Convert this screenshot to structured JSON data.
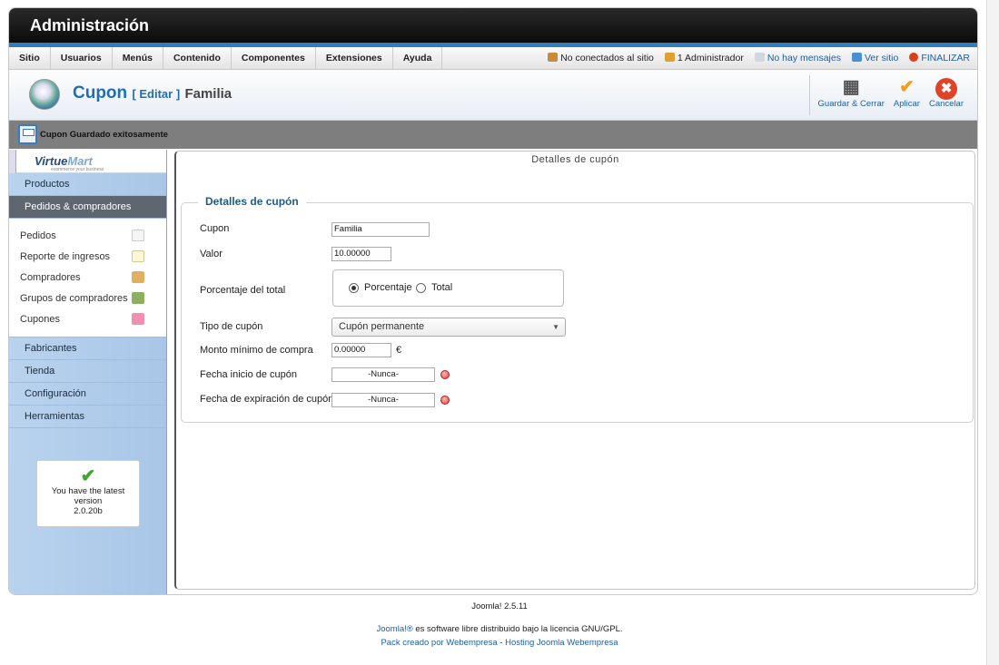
{
  "header": {
    "title": "Administración"
  },
  "menu": [
    "Sitio",
    "Usuarios",
    "Menús",
    "Contenido",
    "Componentes",
    "Extensiones",
    "Ayuda"
  ],
  "status": {
    "offline": "No conectados al sitio",
    "admins": "1 Administrador",
    "messages": "No hay mensajes",
    "view_site": "Ver sitio",
    "logout": "FINALIZAR"
  },
  "page": {
    "title": "Cupon",
    "subtitle": "[ Editar ]",
    "name": "Familia"
  },
  "toolbar": {
    "save_close": "Guardar & Cerrar",
    "apply": "Aplicar",
    "cancel": "Cancelar"
  },
  "message": "Cupon Guardado exitosamente",
  "sidebar": {
    "logo": {
      "part1": "Virtue",
      "part2": "Mart",
      "tagline": "ecommerce your business"
    },
    "sections_top": [
      "Productos",
      "Pedidos & compradores"
    ],
    "subitems": [
      "Pedidos",
      "Reporte de ingresos",
      "Compradores",
      "Grupos de compradores",
      "Cupones"
    ],
    "sections_bottom": [
      "Fabricantes",
      "Tienda",
      "Configuración",
      "Herramientas"
    ],
    "version": {
      "line1": "You have the latest",
      "line2": "version",
      "line3": "2.0.20b"
    }
  },
  "content": {
    "title": "Detalles de cupón",
    "legend": "Detalles de cupón",
    "fields": {
      "cupon": {
        "label": "Cupon",
        "value": "Familia"
      },
      "valor": {
        "label": "Valor",
        "value": "10.00000"
      },
      "porcentaje": {
        "label": "Porcentaje del total",
        "opt1": "Porcentaje",
        "opt2": "Total",
        "selected": "Porcentaje"
      },
      "tipo": {
        "label": "Tipo de cupón",
        "value": "Cupón permanente"
      },
      "monto": {
        "label": "Monto mínimo de compra",
        "value": "0.00000",
        "currency": "€"
      },
      "inicio": {
        "label": "Fecha inicio de cupón",
        "value": "-Nunca-"
      },
      "expira": {
        "label": "Fecha de expiración de cupón",
        "value": "-Nunca-"
      }
    }
  },
  "footer": {
    "version": "Joomla! 2.5.11",
    "license_link": "Joomla!®",
    "license_text": " es software libre distribuido bajo la licencia GNU/GPL.",
    "pack_text": "Pack creado por ",
    "pack_link": "Webempresa",
    "sep": " - ",
    "hosting_link": "Hosting Joomla Webempresa"
  }
}
